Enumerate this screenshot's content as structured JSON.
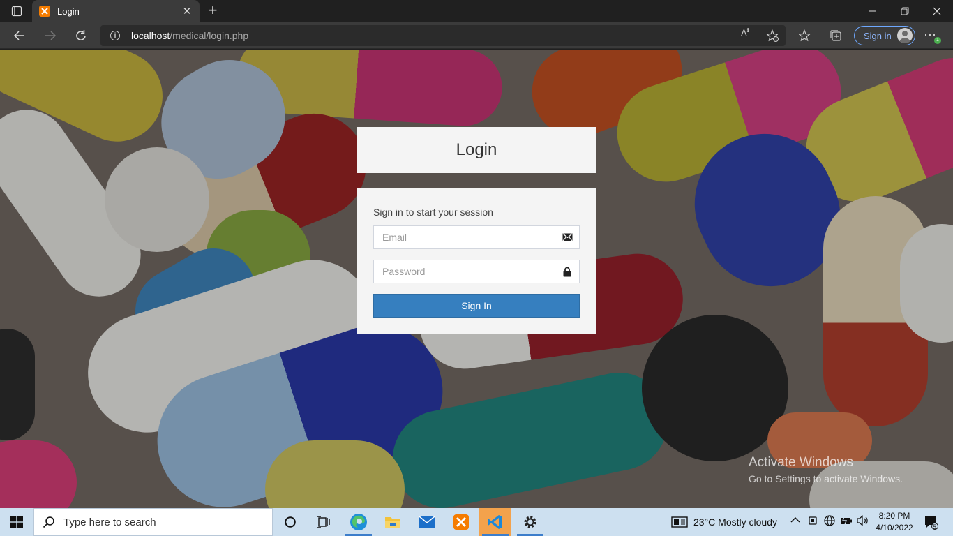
{
  "browser": {
    "tab_title": "Login",
    "url_host": "localhost",
    "url_path": "/medical/login.php",
    "signin_label": "Sign in",
    "notification_count": "1"
  },
  "login": {
    "title": "Login",
    "message": "Sign in to start your session",
    "email_placeholder": "Email",
    "password_placeholder": "Password",
    "submit_label": "Sign In"
  },
  "watermark": {
    "title": "Activate Windows",
    "subtitle": "Go to Settings to activate Windows."
  },
  "taskbar": {
    "search_placeholder": "Type here to search",
    "weather": "23°C  Mostly cloudy",
    "time": "8:20 PM",
    "date": "4/10/2022",
    "notifications": "5"
  },
  "colors": {
    "accent": "#367fbf",
    "taskbar": "#cde0f0",
    "chrome": "#202020"
  }
}
